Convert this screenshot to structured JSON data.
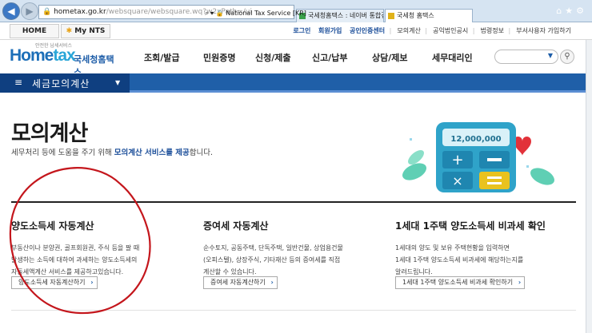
{
  "browser": {
    "url_host": "hometax.go.kr",
    "url_rest": "/websquare/websquare.wq?w2xPath=/ui",
    "address_suffix": "National Tax Service [KR]",
    "tabs": [
      {
        "label": "국세청홈택스 : 네이버 통합검색"
      },
      {
        "label": "국세청 홈택스"
      }
    ]
  },
  "util": {
    "home": "HOME",
    "mynts": "My NTS",
    "links": [
      "로그인",
      "회원가입",
      "공인인증센터",
      "모의계산",
      "공익법인공시",
      "법령정보",
      "부서사용자 가입하기"
    ]
  },
  "header": {
    "logo_sub": "안전한 납세서비스",
    "logo_text_home": "Home",
    "logo_text_tax": "tax",
    "logo_kr": "국세청홈택스",
    "nav": [
      "조회/발급",
      "민원증명",
      "신청/제출",
      "신고/납부",
      "상담/제보",
      "세무대리인"
    ]
  },
  "subnav": {
    "title": "세금모의계산"
  },
  "main": {
    "title": "모의계산",
    "desc_prefix": "세무처리 등에 도움을 주기 위해 ",
    "desc_highlight": "모의계산 서비스를 제공",
    "desc_suffix": "합니다.",
    "illustration_amount": "12,000,000",
    "sections": [
      {
        "title": "양도소득세 자동계산",
        "desc": "부동산이나 분양권, 골프회원권, 주식 등을 팔 때\n발생하는 소득에 대하여 과세하는 양도소득세의\n자동세액계산 서비스를 제공하고있습니다.",
        "button": "양도소득세 자동계산하기"
      },
      {
        "title": "증여세 자동계산",
        "desc": "순수토지, 공동주택, 단독주택, 일반건물, 상업용건물\n(오피스텔), 상장주식, 기타재산 등의 증여세를 직접\n계산할 수 있습니다.",
        "button": "증여세 자동계산하기"
      },
      {
        "title": "1세대 1주택 양도소득세 비과세 확인",
        "desc": "1세대의 양도 및 보유 주택현황을 입력하면\n1세대 1주택 양도소득세 비과세에 해당하는지를\n알려드립니다.",
        "button": "1세대 1주택 양도소득세 비과세 확인하기"
      }
    ]
  },
  "colors": {
    "brand_blue": "#1f5fa8",
    "dark_blue": "#0f3f80",
    "annotation_red": "#c4161c"
  }
}
